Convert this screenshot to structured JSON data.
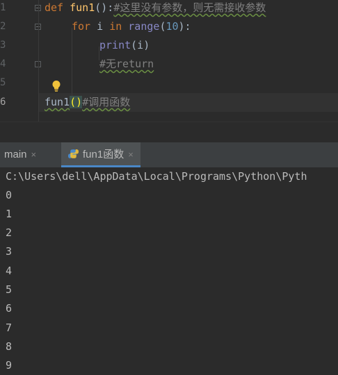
{
  "editor": {
    "line_numbers": [
      "1",
      "2",
      "3",
      "4",
      "5",
      "6"
    ],
    "lines": [
      {
        "kw_def": "def",
        "fn_name": "fun1",
        "parens": "():",
        "comment": "#这里没有参数，则无需接收参数"
      },
      {
        "kw_for": "for",
        "var": "i",
        "kw_in": "in",
        "builtin": "range",
        "open": "(",
        "num": "10",
        "close": "):"
      },
      {
        "builtin": "print",
        "args": "(i)"
      },
      {
        "comment": "#无return"
      },
      {},
      {
        "call": "fun1",
        "parens": "()",
        "comment": "#调用函数"
      }
    ]
  },
  "run_tabs": [
    {
      "label": "main",
      "close": "×"
    },
    {
      "label": "fun1函数",
      "close": "×"
    }
  ],
  "console": {
    "path_line": "C:\\Users\\dell\\AppData\\Local\\Programs\\Python\\Pyth",
    "output": [
      "0",
      "1",
      "2",
      "3",
      "4",
      "5",
      "6",
      "7",
      "8",
      "9"
    ]
  },
  "colors": {
    "editor_bg": "#2b2b2b",
    "keyword": "#cc7832",
    "function": "#ffc66d",
    "builtin": "#8888c6",
    "number": "#6897bb",
    "comment": "#808080",
    "tab_accent": "#4a88c7"
  },
  "icons": [
    "lightbulb-icon",
    "python-icon",
    "fold-icon",
    "close-icon"
  ]
}
